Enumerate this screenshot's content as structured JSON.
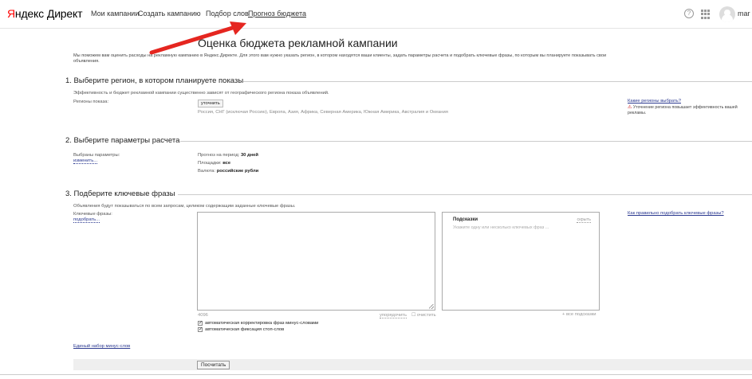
{
  "header": {
    "logo_ya": "Я",
    "logo_rest": "ндекс",
    "logo_product": "Директ",
    "nav": [
      "Мои кампании",
      "Создать кампанию",
      "Подбор слов",
      "Прогноз бюджета"
    ],
    "active_nav": "Прогноз бюджета",
    "help_icon": "?",
    "user": "mar"
  },
  "page": {
    "title": "Оценка бюджета рекламной кампании",
    "intro": "Мы поможем вам оценить расходы на рекламную кампанию в Яндекс.Директе. Для этого вам нужно указать регион, в котором находятся ваши клиенты, задать параметры расчета и подобрать ключевые фразы, по которым вы планируете показывать свои объявления."
  },
  "section1": {
    "title": "1. Выберите регион, в котором планируете показы",
    "desc": "Эффективность и бюджет рекламной кампании существенно зависят от географического региона показа объявлений.",
    "label": "Регионы показа:",
    "button": "уточнить",
    "regions": "Россия, СНГ (исключая Россию), Европа, Азия, Африка, Северная Америка, Южная Америка, Австралия и Океания",
    "help_link": "Какие регионы выбрать?",
    "warn_text": "Уточнение региона повышает эффективность вашей рекламы."
  },
  "section2": {
    "title": "2. Выберите параметры расчета",
    "label": "Выбраны параметры:",
    "change_link": "изменить...",
    "period_label": "Прогноз на период:",
    "period_value": "30 дней",
    "sites_label": "Площадки:",
    "sites_value": "все",
    "currency_label": "Валюта:",
    "currency_value": "российские рубли"
  },
  "section3": {
    "title": "3. Подберите ключевые фразы",
    "desc": "Объявления будут показываться по всем запросам, целиком содержащим заданные ключевые фразы.",
    "label": "Ключевые фразы:",
    "pick_link": "подобрать...",
    "hints_title": "Подсказки",
    "hints_hide": "скрыть",
    "hints_placeholder": "Укажите одну или несколько ключевых фраз ...",
    "counter": "4096",
    "sort_link": "упорядочить",
    "clear_label": "очистить",
    "more_hints": "+ все подсказки",
    "check1": "автоматическая корректировка фраз минус-словами",
    "check2": "автоматическая фиксация стоп-слов",
    "help_link": "Как правильно подобрать ключевые фразы?",
    "minus_link": "Единый набор минус-слов"
  },
  "footer": {
    "calc_button": "Посчитать"
  },
  "colors": {
    "accent_red": "#e52620",
    "link": "#2b3990"
  }
}
